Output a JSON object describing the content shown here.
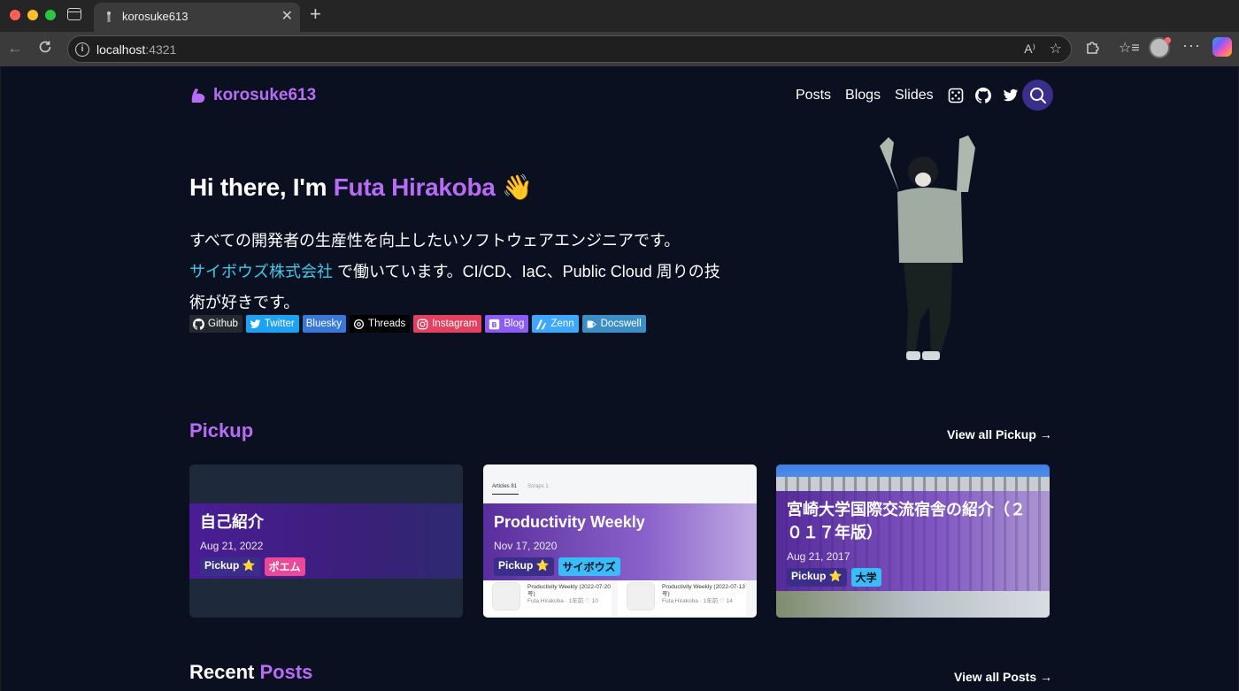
{
  "browser": {
    "tab_title": "korosuke613",
    "url_host": "localhost",
    "url_port": ":4321",
    "new_tab": "+",
    "close": "✕"
  },
  "header": {
    "logo": "korosuke613",
    "nav": [
      "Posts",
      "Blogs",
      "Slides"
    ],
    "accent_color": "#b86bf5"
  },
  "hero": {
    "greeting": "Hi there, I'm ",
    "name": "Futa Hirakoba",
    "emoji": "👋",
    "desc_line1": "すべての開発者の生産性を向上したいソフトウェアエンジニアです。",
    "company": "サイボウズ株式会社",
    "desc_line2": " で働いています。CI/CD、IaC、Public Cloud 周りの技術が好きです。"
  },
  "badges": [
    {
      "label": "Github",
      "color": "#24292e",
      "icon": "github-icon"
    },
    {
      "label": "Twitter",
      "color": "#1da1f2",
      "icon": "twitter-icon"
    },
    {
      "label": "Bluesky",
      "color": "#3a78d8",
      "icon": ""
    },
    {
      "label": "Threads",
      "color": "#000000",
      "icon": "threads-icon"
    },
    {
      "label": "Instagram",
      "color": "#e4405f",
      "icon": "instagram-icon"
    },
    {
      "label": "Blog",
      "color": "#8b5cf6",
      "icon": "blog-icon"
    },
    {
      "label": "Zenn",
      "color": "#3ea8ff",
      "icon": "zenn-icon"
    },
    {
      "label": "Docswell",
      "color": "#3b8fc4",
      "icon": "docswell-icon"
    }
  ],
  "pickup": {
    "title": "Pickup",
    "view_all": "View all Pickup →",
    "cards": [
      {
        "title": "自己紹介",
        "date": "Aug 21, 2022",
        "tags": [
          "Pickup ⭐",
          "ポエム"
        ]
      },
      {
        "title": "Productivity Weekly",
        "date": "Nov 17, 2020",
        "tags": [
          "Pickup ⭐",
          "サイボウズ"
        ],
        "bg_tabs": [
          "Articles 81",
          "Scraps 1"
        ],
        "bg_items": [
          {
            "title": "Productivity Weekly (2022-07-20号)",
            "meta": "Futa Hirakoba · 1年前 ♡ 10"
          },
          {
            "title": "Productivity Weekly (2022-07-13号)",
            "meta": "Futa Hirakoba · 1年前 ♡ 14"
          }
        ]
      },
      {
        "title": "宮崎大学国際交流宿舎の紹介（２０１７年版）",
        "date": "Aug 21, 2017",
        "tags": [
          "Pickup ⭐",
          "大学"
        ]
      }
    ]
  },
  "recent": {
    "title_prefix": "Recent ",
    "title_accent": "Posts",
    "view_all": "View all Posts →"
  }
}
